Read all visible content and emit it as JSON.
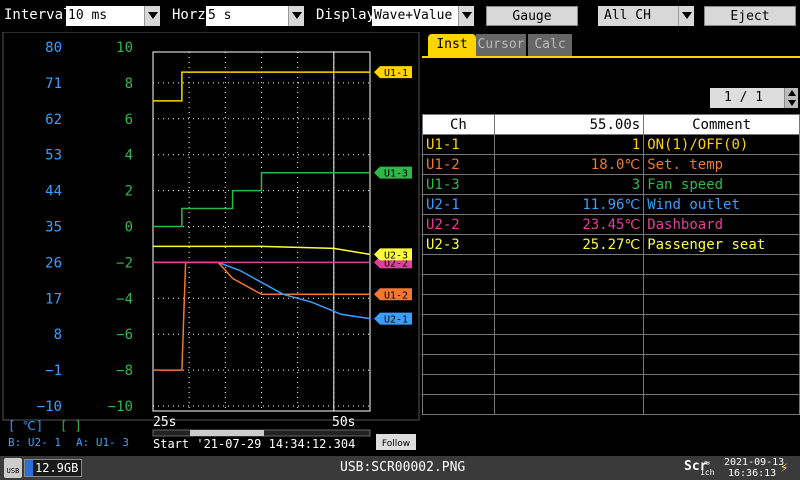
{
  "toolbar": {
    "interval_label": "Interval",
    "interval_value": "10 ms",
    "horz_label": "Horz",
    "horz_value": "5 s",
    "display_label": "Display",
    "display_value": "Wave+Value",
    "gauge_label": "Gauge",
    "channel_value": "All CH",
    "eject_label": "Eject"
  },
  "axes": {
    "left_scale": [
      "80",
      "71",
      "62",
      "53",
      "44",
      "35",
      "26",
      "17",
      "8",
      "−1",
      "−10"
    ],
    "right_scale": [
      "10",
      "8",
      "6",
      "4",
      "2",
      "0",
      "−2",
      "−4",
      "−6",
      "−8",
      "−10"
    ],
    "left_unit": "[  ℃]",
    "right_unit": "[     ]",
    "b_label": "B:  U2- 1",
    "a_label": "A:  U1-  3",
    "x_start": "25s",
    "x_end": "50s",
    "start_time": "Start '21-07-29 14:34:12.304",
    "follow_label": "Follow"
  },
  "chart_data": {
    "type": "line",
    "xlabel": "",
    "ylabel": "",
    "x_range": [
      25,
      55
    ],
    "x_ticks": [
      "25s",
      "50s"
    ],
    "right_axis": {
      "ylim": [
        -10,
        10
      ],
      "unit": ""
    },
    "left_axis": {
      "ylim": [
        -10,
        80
      ],
      "unit": "℃"
    },
    "series": [
      {
        "name": "U1-1",
        "color": "#ffd400",
        "axis": "right",
        "x": [
          25,
          29,
          29,
          55
        ],
        "y": [
          7,
          7,
          8.6,
          8.6
        ]
      },
      {
        "name": "U1-3",
        "color": "#2fb84a",
        "axis": "right",
        "x": [
          25,
          29,
          29,
          36,
          36,
          40,
          40,
          55
        ],
        "y": [
          0,
          0,
          1,
          1,
          2,
          2,
          3,
          3
        ]
      },
      {
        "name": "U1-2",
        "color": "#f07830",
        "axis": "left",
        "x": [
          25,
          29,
          29.5,
          34,
          36,
          40,
          55
        ],
        "y": [
          -1,
          -1,
          26,
          26,
          22,
          18,
          18
        ]
      },
      {
        "name": "U2-1",
        "color": "#3aa0ff",
        "axis": "left",
        "x": [
          25,
          30,
          34,
          37,
          39,
          43,
          47,
          51,
          55
        ],
        "y": [
          26,
          26,
          26,
          24,
          22,
          18,
          16,
          13,
          11.9
        ]
      },
      {
        "name": "U2-2",
        "color": "#e0409a",
        "axis": "left",
        "x": [
          25,
          40,
          55
        ],
        "y": [
          26,
          26,
          26
        ]
      },
      {
        "name": "U2-3",
        "color": "#ffff40",
        "axis": "left",
        "x": [
          25,
          40,
          50,
          55
        ],
        "y": [
          30,
          30,
          29.5,
          28
        ]
      }
    ]
  },
  "tabs": {
    "inst": "Inst",
    "cursor": "Cursor",
    "calc": "Calc"
  },
  "page_indicator": "1 / 1",
  "table": {
    "headers": {
      "ch": "Ch",
      "value": "55.00s",
      "comment": "Comment"
    },
    "rows": [
      {
        "ch": "U1-1",
        "value": "1",
        "comment": "ON(1)/OFF(0)",
        "color": "#ffd400"
      },
      {
        "ch": "U1-2",
        "value": "18.0℃",
        "comment": "Set. temp",
        "color": "#f07830"
      },
      {
        "ch": "U1-3",
        "value": "3",
        "comment": "Fan speed",
        "color": "#2fb84a"
      },
      {
        "ch": "U2-1",
        "value": "11.96℃",
        "comment": "Wind outlet",
        "color": "#3aa0ff"
      },
      {
        "ch": "U2-2",
        "value": "23.45℃",
        "comment": "Dashboard",
        "color": "#e0409a"
      },
      {
        "ch": "U2-3",
        "value": "25.27℃",
        "comment": "Passenger seat",
        "color": "#ffff40"
      }
    ]
  },
  "status": {
    "usb_label": "USB",
    "disk_free": "12.9GB",
    "disk_fill_fraction": 0.15,
    "file_name": "USB:SCR00002.PNG",
    "scr_label": "Scr",
    "scr_sub": "1ch",
    "date": "2021-09-13",
    "time": "16:36:13"
  }
}
